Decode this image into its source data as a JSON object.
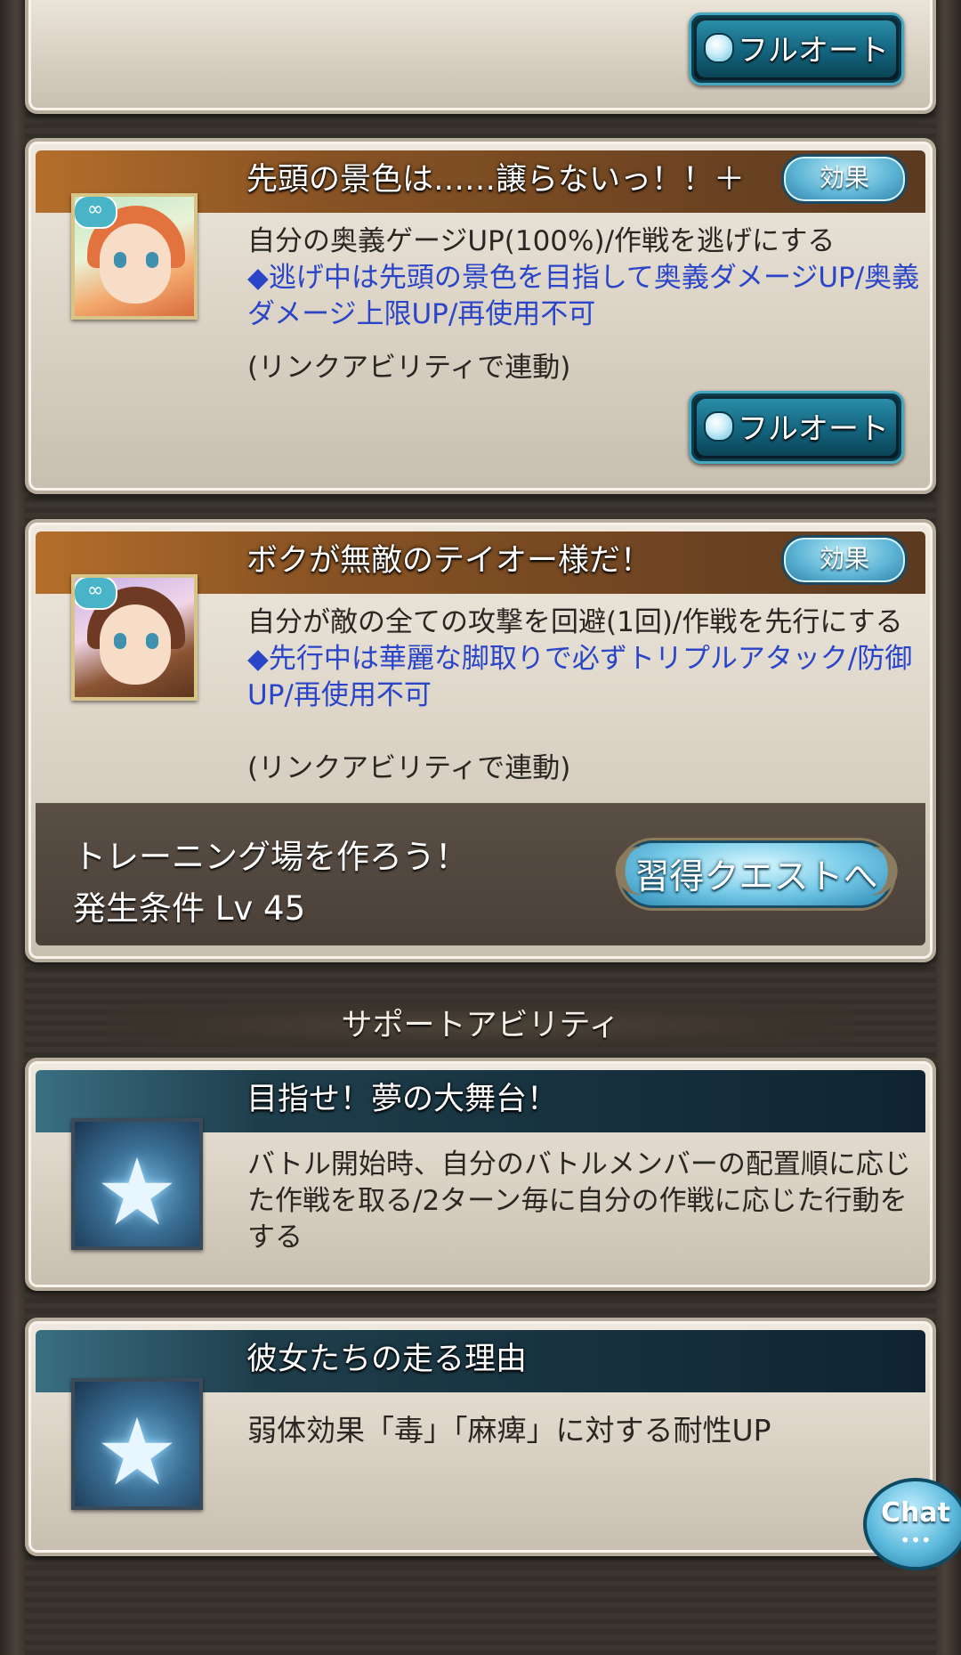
{
  "top_card": {
    "fullauto_label": "フルオート"
  },
  "cards": [
    {
      "title": "先頭の景色は……譲らないっ！！＋",
      "effect_label": "効果",
      "icon": "character-portrait-orange-hair",
      "desc_black": "自分の奥義ゲージUP(100%)/作戦を逃げにする",
      "desc_blue": "◆逃げ中は先頭の景色を目指して奥義ダメージUP/奥義ダメージ上限UP/再使用不可",
      "link_note": "(リンクアビリティで連動)",
      "fullauto_label": "フルオート"
    },
    {
      "title": "ボクが無敵のテイオー様だ！",
      "effect_label": "効果",
      "icon": "character-portrait-brown-hair",
      "desc_black": "自分が敵の全ての攻撃を回避(1回)/作戦を先行にする　",
      "desc_blue": "◆先行中は華麗な脚取りで必ずトリプルアタック/防御UP/再使用不可",
      "link_note": "(リンクアビリティで連動)"
    }
  ],
  "training": {
    "title": "トレーニング場を作ろう！",
    "condition": "発生条件 Lv 45",
    "quest_button": "習得クエストへ"
  },
  "support_heading": "サポートアビリティ",
  "support": [
    {
      "title": "目指せ！夢の大舞台！",
      "icon": "star-icon",
      "desc": "バトル開始時、自分のバトルメンバーの配置順に応じた作戦を取る/2ターン毎に自分の作戦に応じた行動をする"
    },
    {
      "title": "彼女たちの走る理由",
      "icon": "star-icon",
      "desc": "弱体効果「毒」「麻痺」に対する耐性UP"
    }
  ],
  "chat": {
    "label": "Chat",
    "dots": "•••"
  },
  "colors": {
    "brown_header": "#8a5424",
    "teal_header": "#1f3e4c",
    "blue_text": "#2a45c8"
  }
}
